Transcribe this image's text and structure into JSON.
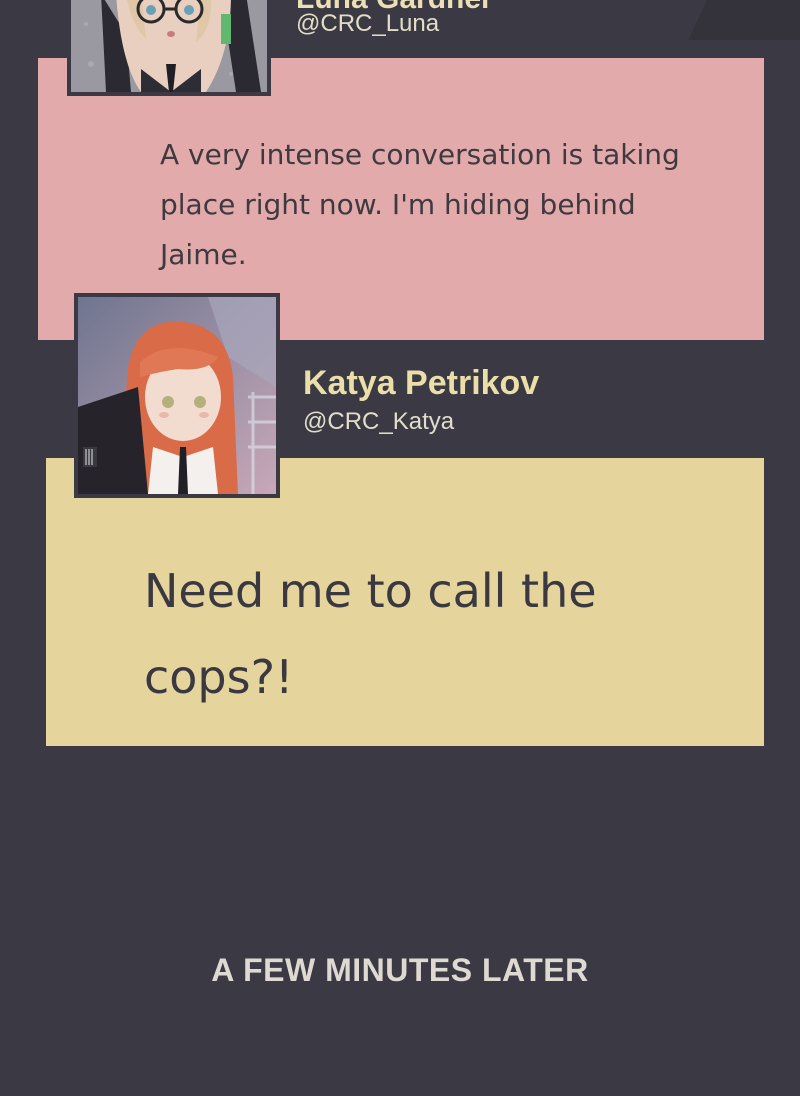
{
  "posts": [
    {
      "name": "Luna Gardner",
      "handle": "@CRC_Luna",
      "message": "A very intense conversation is taking place right now. I'm hiding behind Jaime.",
      "card_color": "#e2aaaa"
    },
    {
      "name": "Katya Petrikov",
      "handle": "@CRC_Katya",
      "message": "Need me to call the cops?!",
      "card_color": "#e6d49d"
    }
  ],
  "caption": "A FEW MINUTES LATER",
  "colors": {
    "background": "#3b3a44",
    "name_text": "#eadfa8",
    "body_text": "#3a3840"
  }
}
